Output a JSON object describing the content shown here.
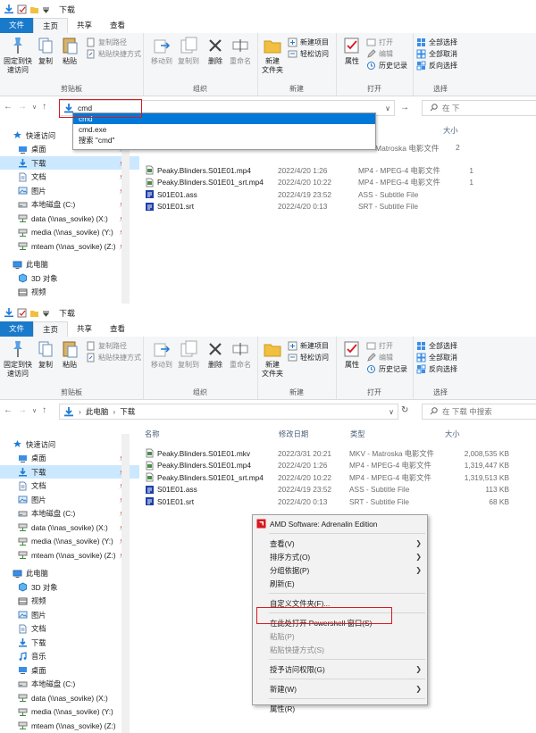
{
  "colors": {
    "file_tab": "#1979ca",
    "selection": "#cce8ff",
    "dropdown_sel": "#0078d7",
    "highlight_box": "#d9181f",
    "folder": "#f1c040",
    "download": "#1e7ad6"
  },
  "window_title": "下载",
  "ribbon_tabs": {
    "file": "文件",
    "home": "主页",
    "share": "共享",
    "view": "查看"
  },
  "ribbon": {
    "pin_quick": "固定到快\n速访问",
    "copy": "复制",
    "paste": "粘贴",
    "copy_path": "复制路径",
    "paste_shortcut": "粘贴快捷方式",
    "group_clipboard": "剪贴板",
    "move_to": "移动到",
    "copy_to": "复制到",
    "delete": "删除",
    "rename": "重命名",
    "group_organize": "组织",
    "new_folder": "新建\n文件夹",
    "new_item": "新建项目",
    "easy_access": "轻松访问",
    "group_new": "新建",
    "properties": "属性",
    "open": "打开",
    "edit": "编辑",
    "history": "历史记录",
    "group_open": "打开",
    "select_all": "全部选择",
    "select_none": "全部取消",
    "invert": "反向选择",
    "group_select": "选择"
  },
  "win1": {
    "address_value": "cmd",
    "search_placeholder": "在 下",
    "dropdown": [
      "cmd",
      "cmd.exe",
      "搜索 \"cmd\""
    ],
    "col_size_partial": "大小"
  },
  "win2": {
    "breadcrumb": [
      "此电脑",
      "下载"
    ],
    "search_placeholder": "在 下载 中搜索",
    "columns": {
      "name": "名称",
      "date": "修改日期",
      "type": "类型",
      "size": "大小"
    }
  },
  "sidebar1": [
    {
      "label": "快速访问",
      "icon": "star-icon"
    },
    {
      "label": "桌面",
      "icon": "desktop-icon",
      "pin": true
    },
    {
      "label": "下载",
      "icon": "download-icon",
      "pin": true,
      "selected": true
    },
    {
      "label": "文档",
      "icon": "document-icon",
      "pin": true
    },
    {
      "label": "图片",
      "icon": "picture-icon",
      "pin": true
    },
    {
      "label": "本地磁盘 (C:)",
      "icon": "drive-icon",
      "pin": true
    },
    {
      "label": "data (\\\\nas_sovike) (X:)",
      "icon": "network-drive-icon",
      "pin": true
    },
    {
      "label": "media (\\\\nas_sovike) (Y:)",
      "icon": "network-drive-icon",
      "pin": true
    },
    {
      "label": "mteam (\\\\nas_sovike) (Z:)",
      "icon": "network-drive-icon",
      "pin": true
    },
    {
      "label": "此电脑",
      "icon": "computer-icon"
    },
    {
      "label": "3D 对象",
      "icon": "3d-objects-icon"
    },
    {
      "label": "视频",
      "icon": "video-icon"
    }
  ],
  "sidebar2": [
    {
      "label": "快速访问",
      "icon": "star-icon"
    },
    {
      "label": "桌面",
      "icon": "desktop-icon",
      "pin": true
    },
    {
      "label": "下载",
      "icon": "download-icon",
      "pin": true,
      "selected": true
    },
    {
      "label": "文档",
      "icon": "document-icon",
      "pin": true
    },
    {
      "label": "图片",
      "icon": "picture-icon",
      "pin": true
    },
    {
      "label": "本地磁盘 (C:)",
      "icon": "drive-icon",
      "pin": true
    },
    {
      "label": "data (\\\\nas_sovike) (X:)",
      "icon": "network-drive-icon",
      "pin": true
    },
    {
      "label": "media (\\\\nas_sovike) (Y:)",
      "icon": "network-drive-icon",
      "pin": true
    },
    {
      "label": "mteam (\\\\nas_sovike) (Z:)",
      "icon": "network-drive-icon",
      "pin": true
    },
    {
      "label": "此电脑",
      "icon": "computer-icon"
    },
    {
      "label": "3D 对象",
      "icon": "3d-objects-icon"
    },
    {
      "label": "视频",
      "icon": "video-icon"
    },
    {
      "label": "图片",
      "icon": "picture-icon"
    },
    {
      "label": "文档",
      "icon": "document-icon"
    },
    {
      "label": "下载",
      "icon": "download-icon"
    },
    {
      "label": "音乐",
      "icon": "music-icon"
    },
    {
      "label": "桌面",
      "icon": "desktop-icon"
    },
    {
      "label": "本地磁盘 (C:)",
      "icon": "drive-icon"
    },
    {
      "label": "data (\\\\nas_sovike) (X:)",
      "icon": "network-drive-icon"
    },
    {
      "label": "media (\\\\nas_sovike) (Y:)",
      "icon": "network-drive-icon"
    },
    {
      "label": "mteam (\\\\nas_sovike) (Z:)",
      "icon": "network-drive-icon"
    }
  ],
  "files1": [
    {
      "name": "Peaky.Blinders.S01E01.mp4",
      "date": "2022/4/20 1:26",
      "type": "MP4 - MPEG-4 电影文件",
      "size": "1",
      "icon": "video-file-icon"
    },
    {
      "name": "Peaky.Blinders.S01E01_srt.mp4",
      "date": "2022/4/20 10:22",
      "type": "MP4 - MPEG-4 电影文件",
      "size": "1",
      "icon": "video-file-icon"
    },
    {
      "name": "S01E01.ass",
      "date": "2022/4/19 23:52",
      "type": "ASS - Subtitle File",
      "size": "",
      "icon": "subtitle-file-icon"
    },
    {
      "name": "S01E01.srt",
      "date": "2022/4/20 0:13",
      "type": "SRT - Subtitle File",
      "size": "",
      "icon": "subtitle-file-icon"
    }
  ],
  "files1_partial": {
    "type": "Matroska 电影文件",
    "size": "2"
  },
  "files2": [
    {
      "name": "Peaky.Blinders.S01E01.mkv",
      "date": "2022/3/31 20:21",
      "type": "MKV - Matroska 电影文件",
      "size": "2,008,535 KB",
      "icon": "video-file-icon"
    },
    {
      "name": "Peaky.Blinders.S01E01.mp4",
      "date": "2022/4/20 1:26",
      "type": "MP4 - MPEG-4 电影文件",
      "size": "1,319,447 KB",
      "icon": "video-file-icon"
    },
    {
      "name": "Peaky.Blinders.S01E01_srt.mp4",
      "date": "2022/4/20 10:22",
      "type": "MP4 - MPEG-4 电影文件",
      "size": "1,319,513 KB",
      "icon": "video-file-icon"
    },
    {
      "name": "S01E01.ass",
      "date": "2022/4/19 23:52",
      "type": "ASS - Subtitle File",
      "size": "113 KB",
      "icon": "subtitle-file-icon"
    },
    {
      "name": "S01E01.srt",
      "date": "2022/4/20 0:13",
      "type": "SRT - Subtitle File",
      "size": "68 KB",
      "icon": "subtitle-file-icon"
    }
  ],
  "context_menu": [
    {
      "label": "AMD Software: Adrenalin Edition",
      "icon": "amd-icon"
    },
    {
      "sep": true
    },
    {
      "label": "查看(V)",
      "submenu": true
    },
    {
      "label": "排序方式(O)",
      "submenu": true
    },
    {
      "label": "分组依据(P)",
      "submenu": true
    },
    {
      "label": "刷新(E)"
    },
    {
      "sep": true
    },
    {
      "label": "自定义文件夹(F)..."
    },
    {
      "sep": true
    },
    {
      "label": "在此处打开 Powershell 窗口(S)",
      "highlight": true
    },
    {
      "label": "粘贴(P)",
      "disabled": true
    },
    {
      "label": "粘贴快捷方式(S)",
      "disabled": true
    },
    {
      "sep": true
    },
    {
      "label": "授予访问权限(G)",
      "submenu": true
    },
    {
      "sep": true
    },
    {
      "label": "新建(W)",
      "submenu": true
    },
    {
      "sep": true
    },
    {
      "label": "属性(R)"
    }
  ]
}
